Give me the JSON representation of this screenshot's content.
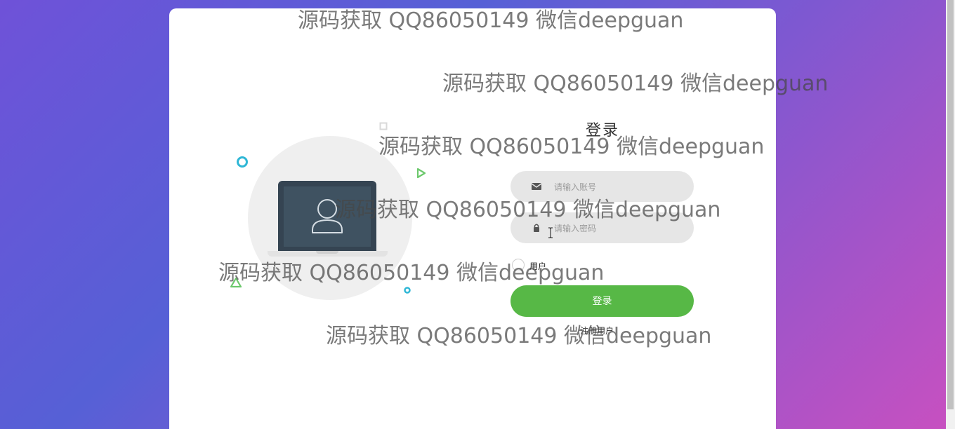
{
  "page": {
    "background_colors": [
      "#6f52d8",
      "#5660d6",
      "#c850c0"
    ]
  },
  "login": {
    "title": "登录",
    "account_placeholder": "请输入账号",
    "account_value": "",
    "account_icon": "envelope-icon",
    "password_placeholder": "请输入密码",
    "password_value": "",
    "password_icon": "lock-icon",
    "role_option": "用户",
    "submit_label": "登录",
    "register_link": "注册用户",
    "button_color": "#57b846"
  },
  "illustration": {
    "icon": "user-icon"
  },
  "watermarks": [
    "源码获取 QQ86050149 微信deepguan",
    "源码获取 QQ86050149 微信deepguan",
    "源码获取 QQ86050149 微信deepguan",
    "源码获取 QQ86050149 微信deepguan",
    "源码获取 QQ86050149 微信deepguan",
    "源码获取 QQ86050149 微信deepguan"
  ]
}
